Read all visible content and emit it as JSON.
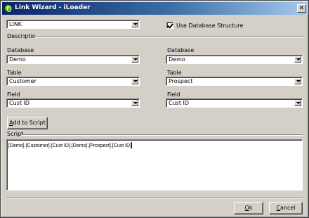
{
  "window": {
    "title": "Link Wizard - iLoader",
    "close_glyph": "✕"
  },
  "link_type": {
    "value": "LINK"
  },
  "use_db_structure": {
    "label": "Use Database Structure",
    "checked": true
  },
  "description": {
    "label": "Descriptio"
  },
  "left": {
    "database_label": "Database",
    "database_value": "Demo",
    "table_label": "Table",
    "table_value": "Customer",
    "field_label": "Field",
    "field_value": "Cust ID"
  },
  "right": {
    "database_label": "Database",
    "database_value": "Demo",
    "table_label": "Table",
    "table_value": "Prospect",
    "field_label": "Field",
    "field_value": "Cust ID"
  },
  "add_to_script": {
    "label_prefix": "A",
    "label_rest": "dd to Script"
  },
  "script": {
    "label": "Script",
    "text": "[Demo].[Customer].[Cust ID].[Demo].[Prospect].[Cust ID]"
  },
  "footer": {
    "ok_mnemonic": "O",
    "ok_rest": "k",
    "cancel_mnemonic": "C",
    "cancel_rest": "ancel"
  }
}
